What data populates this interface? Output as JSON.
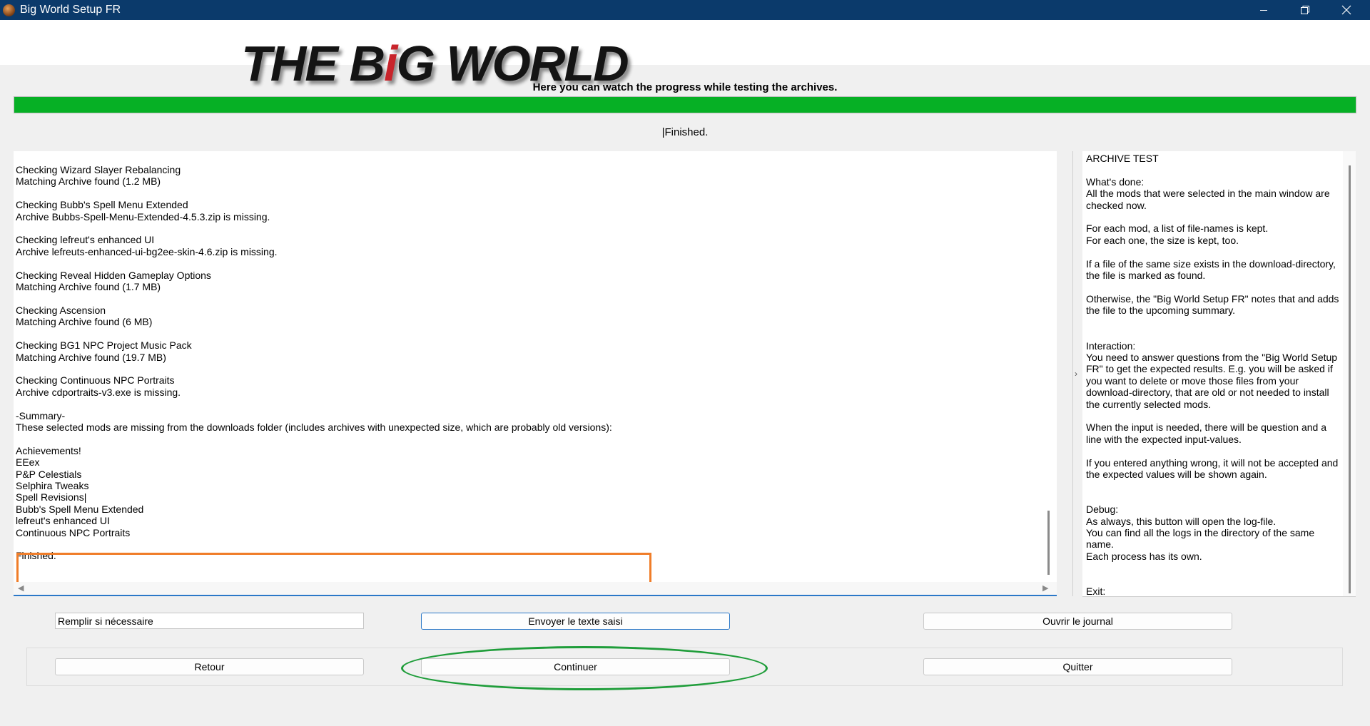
{
  "window": {
    "title": "Big World Setup FR",
    "minimize_icon": "minimize-icon",
    "maximize_icon": "restore-icon",
    "close_icon": "close-icon"
  },
  "logo": {
    "part1": "THE B",
    "part_i": "i",
    "part2": "G WORLD"
  },
  "progress": {
    "label": "Here you can watch the progress while testing the archives.",
    "value_percent": 100,
    "status": "|Finished.",
    "fill_color": "#06b025"
  },
  "log": {
    "text": "Checking Wizard Slayer Rebalancing\nMatching Archive found (1.2 MB)\n\nChecking Bubb's Spell Menu Extended\nArchive Bubbs-Spell-Menu-Extended-4.5.3.zip is missing.\n\nChecking lefreut's enhanced UI\nArchive lefreuts-enhanced-ui-bg2ee-skin-4.6.zip is missing.\n\nChecking Reveal Hidden Gameplay Options\nMatching Archive found (1.7 MB)\n\nChecking Ascension\nMatching Archive found (6 MB)\n\nChecking BG1 NPC Project Music Pack\nMatching Archive found (19.7 MB)\n\nChecking Continuous NPC Portraits\nArchive cdportraits-v3.exe is missing.\n\n-Summary-\nThese selected mods are missing from the downloads folder (includes archives with unexpected size, which are probably old versions):\n\nAchievements!\nEEex\nP&P Celestials\nSelphira Tweaks\nSpell Revisions|\nBubb's Spell Menu Extended\nlefreut's enhanced UI\nContinuous NPC Portraits\n\nFinished.",
    "highlight_color": "#f07d29"
  },
  "help": {
    "text": "ARCHIVE TEST\n\nWhat's done:\nAll the mods that were selected in the main window are checked now.\n\nFor each mod, a list of file-names is kept.\nFor each one, the size is kept, too.\n\nIf a file of the same size exists in the download-directory, the file is marked as found.\n\nOtherwise, the \"Big World Setup FR\" notes that and adds the file to the upcoming summary.\n\n\nInteraction:\nYou need to answer questions from the \"Big World Setup FR\" to get the expected results. E.g. you will be asked if you want to delete or move those files from your download-directory, that are old or not needed to install the currently selected mods.\n\nWhen the input is needed, there will be question and a line with the expected input-values.\n\nIf you entered anything wrong, it will not be accepted and the expected values will be shown again.\n\n\nDebug:\nAs always, this button will open the log-file.\nYou can find all the logs in the directory of the same name.\nEach process has its own.\n\n\nExit:"
  },
  "controls": {
    "input_value": "Remplir si nécessaire",
    "send_label": "Envoyer le texte saisi",
    "open_log_label": "Ouvrir le journal",
    "back_label": "Retour",
    "continue_label": "Continuer",
    "quit_label": "Quitter",
    "continue_highlight_color": "#1f9d3a"
  }
}
